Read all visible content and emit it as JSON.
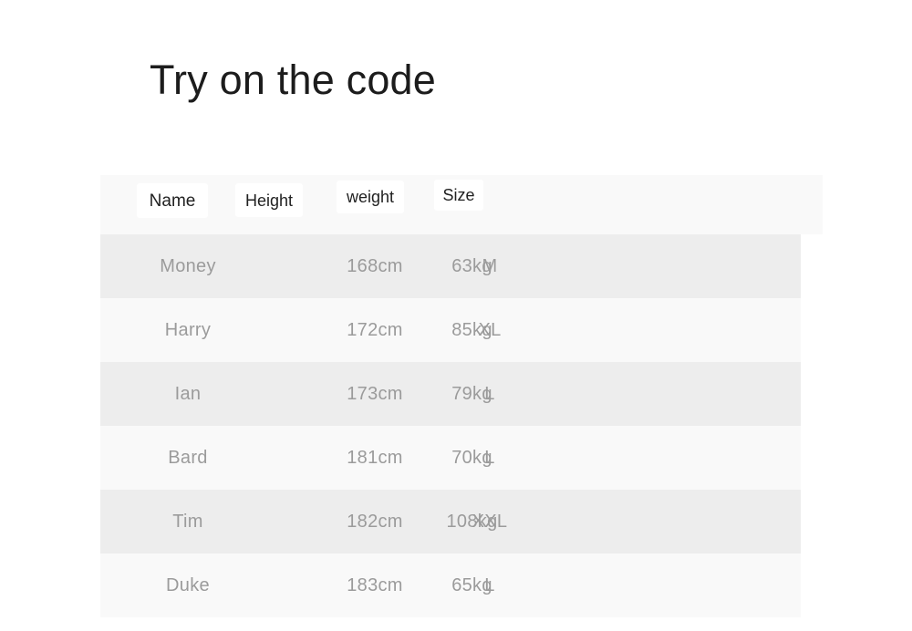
{
  "page": {
    "title": "Try on the code",
    "background_color": "#ffffff"
  },
  "table": {
    "header_background": "#f9f9f9",
    "row_odd_background": "#ededed",
    "row_even_background": "#f9f9f9",
    "cell_text_color": "#9b9b9b",
    "header_text_color": "#212121",
    "columns": [
      {
        "key": "name",
        "label": "Name"
      },
      {
        "key": "height",
        "label": "Height"
      },
      {
        "key": "weight",
        "label": "weight"
      },
      {
        "key": "size",
        "label": "Size"
      }
    ],
    "rows": [
      {
        "name": "Money",
        "height": "168cm",
        "weight": "63kg",
        "size": "M"
      },
      {
        "name": "Harry",
        "height": "172cm",
        "weight": "85kg",
        "size": "XL"
      },
      {
        "name": "Ian",
        "height": "173cm",
        "weight": "79kg",
        "size": "L"
      },
      {
        "name": "Bard",
        "height": "181cm",
        "weight": "70kg",
        "size": "L"
      },
      {
        "name": "Tim",
        "height": "182cm",
        "weight": "108kg",
        "size": "XXL"
      },
      {
        "name": "Duke",
        "height": "183cm",
        "weight": "65kg",
        "size": "L"
      }
    ]
  }
}
